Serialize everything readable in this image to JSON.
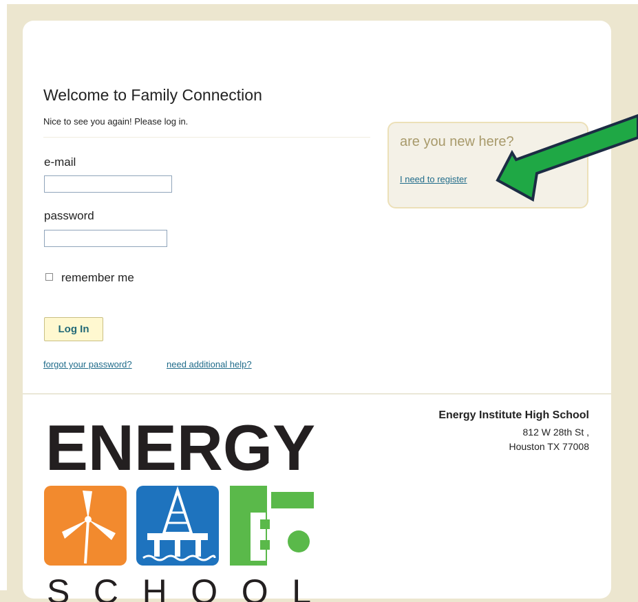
{
  "page": {
    "title": "Welcome to Family Connection",
    "subtitle": "Nice to see you again! Please log in."
  },
  "login_form": {
    "email_label": "e-mail",
    "email_value": "",
    "password_label": "password",
    "password_value": "",
    "remember_label": "remember me",
    "remember_checked": false,
    "login_button": "Log In"
  },
  "links": {
    "forgot_password": "forgot your password?",
    "additional_help": "need additional help?"
  },
  "register": {
    "heading": "are you new here?",
    "link": "I need to register"
  },
  "school": {
    "name": "Energy Institute High School",
    "street": "812 W 28th St ,",
    "city": "Houston TX 77008"
  },
  "logo": {
    "word": "ENERGY",
    "subword": "SCHOOL",
    "colors": {
      "wind": "#f28a2e",
      "oil": "#1e73be",
      "gear": "#5ab94a",
      "text": "#231f20"
    }
  },
  "annotation": {
    "arrow_color": "#1fa845",
    "arrow_outline": "#1c2c44"
  },
  "colors": {
    "background": "#ece6cf",
    "link": "#1f6b8a",
    "button_bg": "#fff8d0",
    "register_heading": "#a89a6b"
  }
}
